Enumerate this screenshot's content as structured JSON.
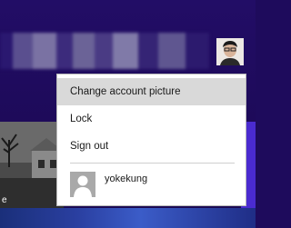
{
  "background": {
    "start_screen_color": "#1e0b5c",
    "blurred_title_colors": [
      "#2a1870",
      "#5a4f8f",
      "#7a72a3",
      "#3c2b7c",
      "#6b6397",
      "#4a3b84",
      "#807aa8",
      "#352475",
      "#5f5690",
      "#2c1a6e"
    ]
  },
  "tiles": {
    "left_tile_caption": "e"
  },
  "account_menu": {
    "items": [
      {
        "label": "Change account picture",
        "selected": true
      },
      {
        "label": "Lock",
        "selected": false
      },
      {
        "label": "Sign out",
        "selected": false
      }
    ],
    "other_user": {
      "name": "yokekung"
    }
  },
  "colors": {
    "menu_background": "#ffffff",
    "menu_selected_background": "#d9d9d9",
    "menu_text": "#1a1a1a",
    "generic_avatar": "#b0b0b0"
  },
  "icons": {
    "current_user_avatar": "user-photo",
    "other_user_avatar": "person-silhouette-icon"
  }
}
